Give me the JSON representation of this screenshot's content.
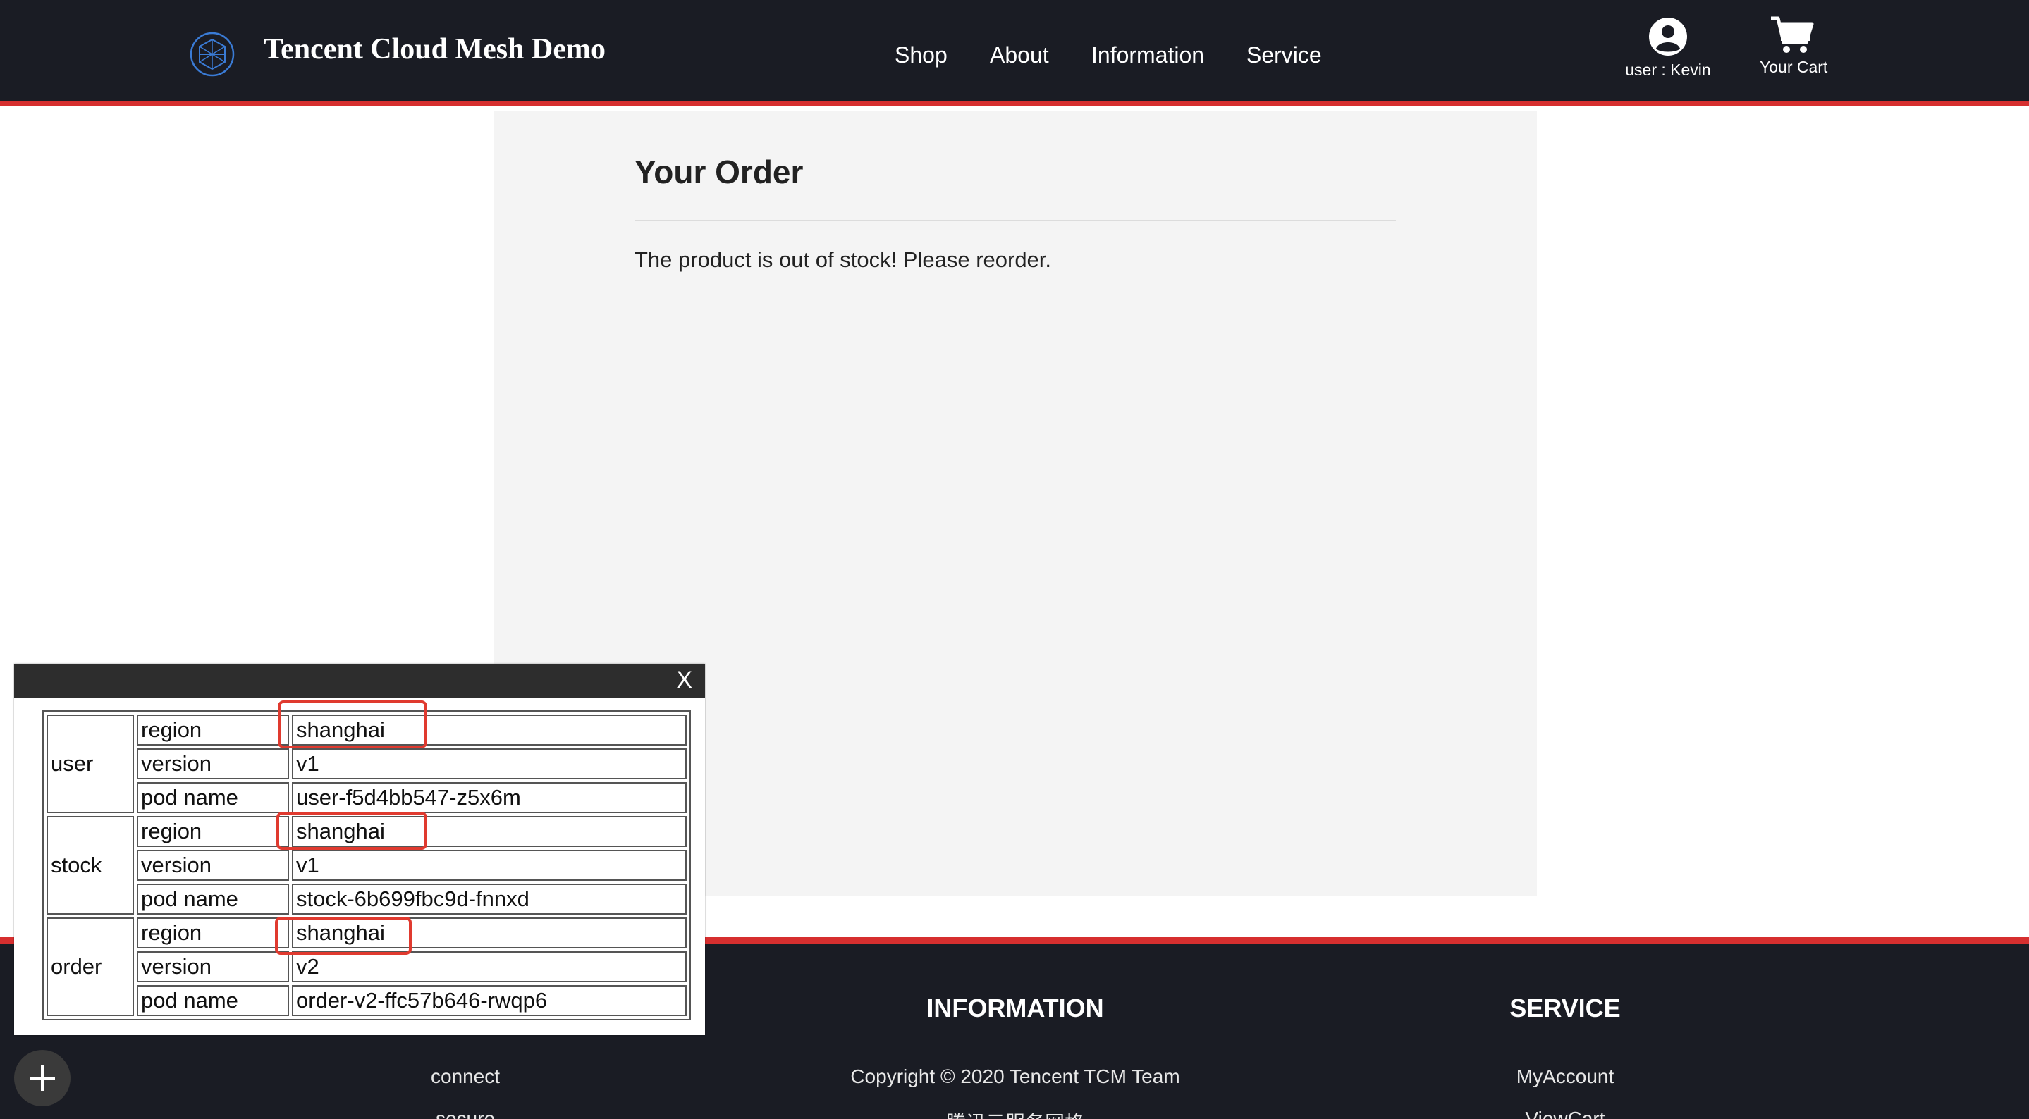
{
  "header": {
    "brand": "Tencent Cloud Mesh Demo",
    "nav": [
      "Shop",
      "About",
      "Information",
      "Service"
    ],
    "user_label": "user : Kevin",
    "cart_label": "Your Cart"
  },
  "order": {
    "title": "Your Order",
    "message": "The product is out of stock! Please reorder."
  },
  "debug_panel": {
    "close_label": "X",
    "groups": [
      {
        "name": "user",
        "rows": [
          {
            "key": "region",
            "value": "shanghai"
          },
          {
            "key": "version",
            "value": "v1"
          },
          {
            "key": "pod name",
            "value": "user-f5d4bb547-z5x6m"
          }
        ]
      },
      {
        "name": "stock",
        "rows": [
          {
            "key": "region",
            "value": "shanghai"
          },
          {
            "key": "version",
            "value": "v1"
          },
          {
            "key": "pod name",
            "value": "stock-6b699fbc9d-fnnxd"
          }
        ]
      },
      {
        "name": "order",
        "rows": [
          {
            "key": "region",
            "value": "shanghai"
          },
          {
            "key": "version",
            "value": "v2"
          },
          {
            "key": "pod name",
            "value": "order-v2-ffc57b646-rwqp6"
          }
        ]
      }
    ]
  },
  "footer": {
    "information_heading": "INFORMATION",
    "service_heading": "SERVICE",
    "col1_links": [
      "connect",
      "secure"
    ],
    "information_links": [
      "Copyright © 2020 Tencent TCM Team",
      "腾讯云服务网格"
    ],
    "service_links": [
      "MyAccount",
      "ViewCart"
    ]
  },
  "colors": {
    "header_bg": "#1a1c24",
    "accent_red": "#d62f2f",
    "panel_bg": "#f4f4f4",
    "highlight": "#e03a2f"
  },
  "icons": [
    "mesh-logo-icon",
    "user-circle-icon",
    "cart-icon",
    "close-icon",
    "plus-icon"
  ]
}
